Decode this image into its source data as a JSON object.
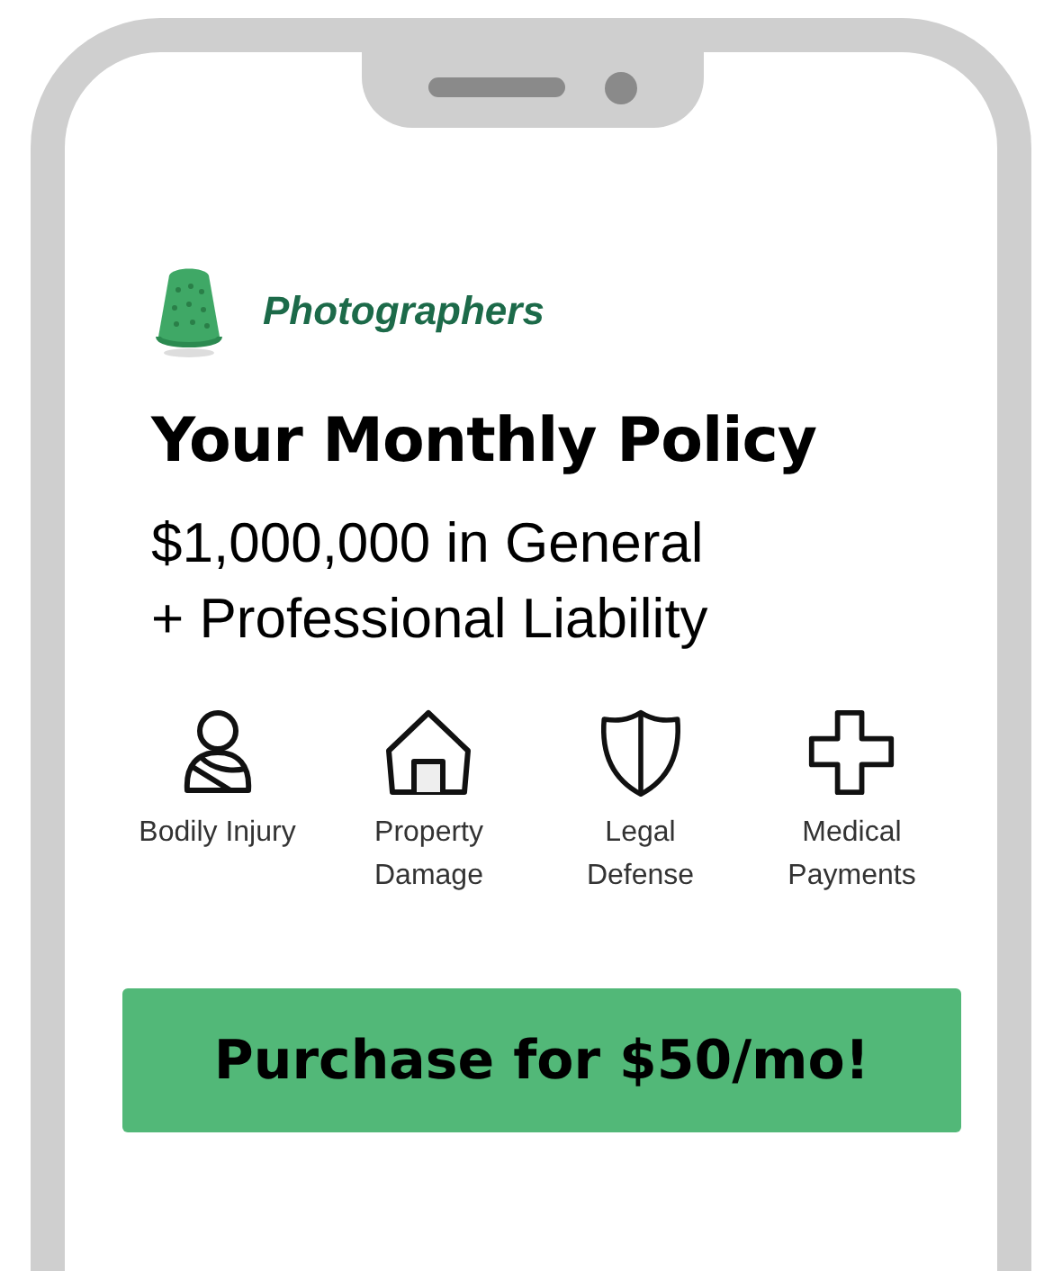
{
  "brand": {
    "label": "Photographers"
  },
  "title": "Your Monthly Policy",
  "subtitle": [
    "$1,000,000 in General",
    "+ Professional Liability"
  ],
  "coverages": [
    {
      "label": "Bodily Injury"
    },
    {
      "label": "Property Damage"
    },
    {
      "label": "Legal Defense"
    },
    {
      "label": "Medical Payments"
    }
  ],
  "purchase_button": "Purchase for $50/mo!"
}
